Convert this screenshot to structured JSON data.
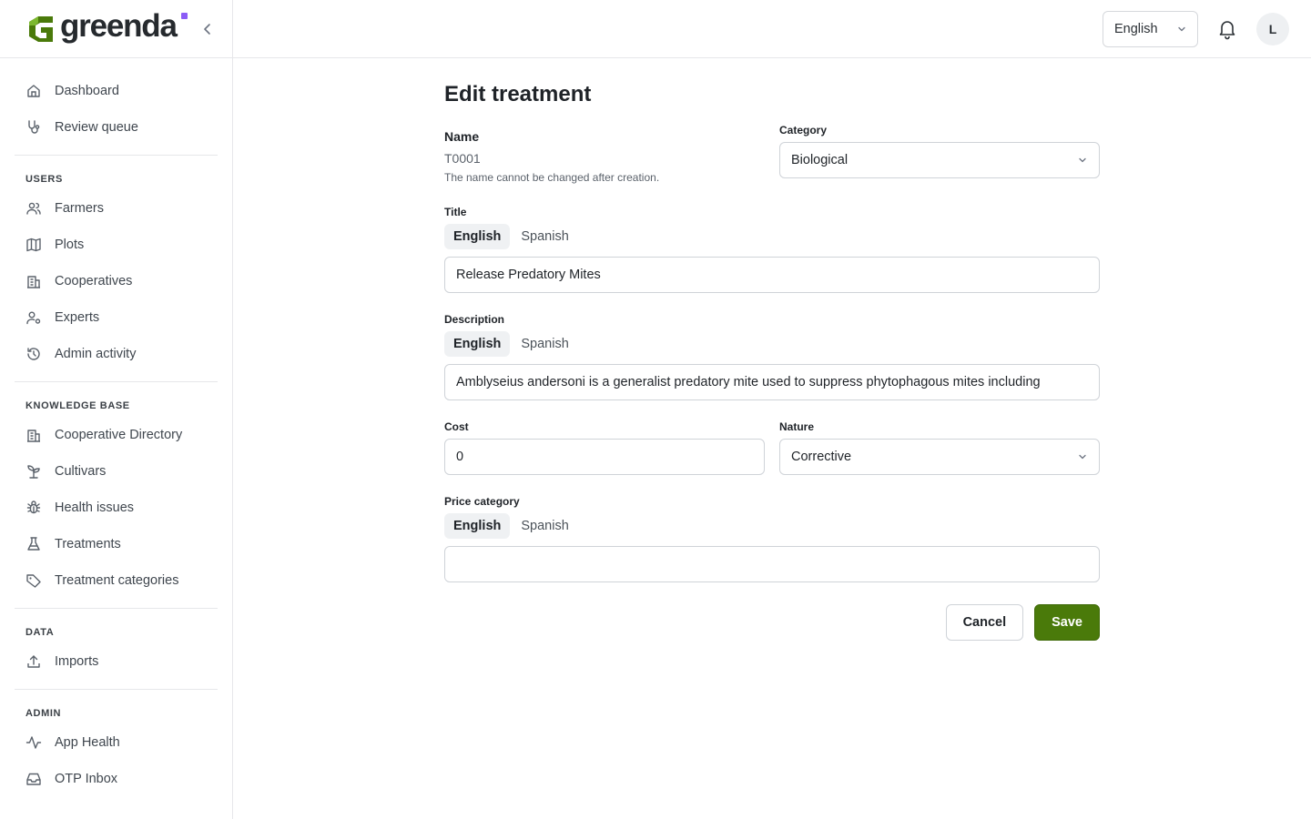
{
  "brand": {
    "name": "greenda",
    "accent": "#8b5cf6",
    "logo_color": "#4a7a0a"
  },
  "sidebar": {
    "groups": [
      {
        "label": "",
        "items": [
          {
            "label": "Dashboard",
            "icon": "home-icon"
          },
          {
            "label": "Review queue",
            "icon": "stethoscope-icon"
          }
        ]
      },
      {
        "label": "USERS",
        "items": [
          {
            "label": "Farmers",
            "icon": "users-icon"
          },
          {
            "label": "Plots",
            "icon": "map-icon"
          },
          {
            "label": "Cooperatives",
            "icon": "building-icon"
          },
          {
            "label": "Experts",
            "icon": "user-cog-icon"
          },
          {
            "label": "Admin activity",
            "icon": "history-icon"
          }
        ]
      },
      {
        "label": "KNOWLEDGE BASE",
        "items": [
          {
            "label": "Cooperative Directory",
            "icon": "building-icon"
          },
          {
            "label": "Cultivars",
            "icon": "sprout-icon"
          },
          {
            "label": "Health issues",
            "icon": "bug-icon"
          },
          {
            "label": "Treatments",
            "icon": "flask-icon"
          },
          {
            "label": "Treatment categories",
            "icon": "tag-icon"
          }
        ]
      },
      {
        "label": "DATA",
        "items": [
          {
            "label": "Imports",
            "icon": "upload-icon"
          }
        ]
      },
      {
        "label": "ADMIN",
        "items": [
          {
            "label": "App Health",
            "icon": "activity-icon"
          },
          {
            "label": "OTP Inbox",
            "icon": "inbox-icon"
          }
        ]
      }
    ]
  },
  "topbar": {
    "language": "English",
    "avatar_initial": "L"
  },
  "form": {
    "title": "Edit treatment",
    "name": {
      "label": "Name",
      "value": "T0001",
      "help": "The name cannot be changed after creation."
    },
    "category": {
      "label": "Category",
      "value": "Biological"
    },
    "title_field": {
      "label": "Title",
      "tabs": [
        "English",
        "Spanish"
      ],
      "active_tab": "English",
      "value": "Release Predatory Mites"
    },
    "description": {
      "label": "Description",
      "tabs": [
        "English",
        "Spanish"
      ],
      "active_tab": "English",
      "value": "Amblyseius andersoni is a generalist predatory mite used to suppress phytophagous mites including"
    },
    "cost": {
      "label": "Cost",
      "value": "0"
    },
    "nature": {
      "label": "Nature",
      "value": "Corrective"
    },
    "price_category": {
      "label": "Price category",
      "tabs": [
        "English",
        "Spanish"
      ],
      "active_tab": "English",
      "value": ""
    },
    "cancel_label": "Cancel",
    "save_label": "Save",
    "save_color": "#4a7a0a"
  }
}
